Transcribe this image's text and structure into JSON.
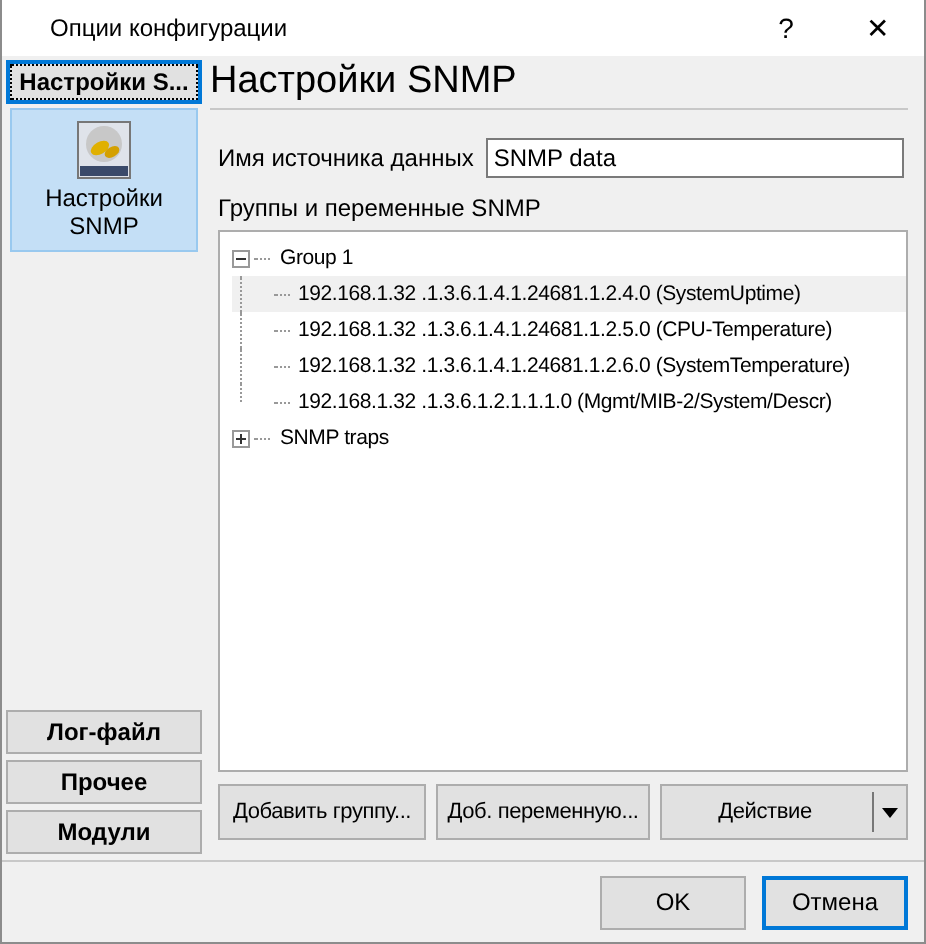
{
  "window": {
    "title": "Опции конфигурации",
    "buttons": [
      "?",
      "✕"
    ]
  },
  "sidebar": {
    "header": "Настройки S...",
    "items": [
      {
        "label": "Настройки SNMP",
        "selected": true
      }
    ],
    "bottom_buttons": [
      "Лог-файл",
      "Прочее",
      "Модули"
    ]
  },
  "panel": {
    "title": "Настройки SNMP",
    "source_label": "Имя источника данных",
    "source_value": "SNMP data",
    "tree_label": "Группы и переменные SNMP",
    "tree": [
      {
        "label": "Group 1",
        "expanded": true,
        "children": [
          {
            "label": "192.168.1.32 .1.3.6.1.4.1.24681.1.2.4.0 (SystemUptime)",
            "selected": true
          },
          {
            "label": "192.168.1.32 .1.3.6.1.4.1.24681.1.2.5.0 (CPU-Temperature)",
            "selected": false
          },
          {
            "label": "192.168.1.32 .1.3.6.1.4.1.24681.1.2.6.0 (SystemTemperature)",
            "selected": false
          },
          {
            "label": "192.168.1.32 .1.3.6.1.2.1.1.1.0 (Mgmt/MIB-2/System/Descr)",
            "selected": false
          }
        ]
      },
      {
        "label": "SNMP traps",
        "expanded": false
      }
    ],
    "buttons": [
      "Добавить группу...",
      "Доб. переменную...",
      "Действие"
    ]
  },
  "footer": {
    "buttons": [
      {
        "label": "OK",
        "default": false
      },
      {
        "label": "Отмена",
        "default": true
      }
    ]
  }
}
